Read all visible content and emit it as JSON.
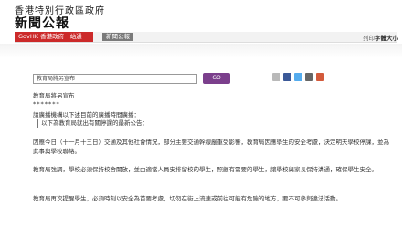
{
  "header": {
    "gov_name": "香港特別行政區政府",
    "title": "新聞公報"
  },
  "tabs": {
    "govhk": "GovHK 香港政府一站通",
    "archive": "新聞公報"
  },
  "tools": {
    "print": "列印",
    "font_size": "字體大小"
  },
  "search": {
    "value": "教育局將另宣布"
  },
  "go_button": "GO",
  "content": {
    "heading": "教育局將另宣布",
    "asterisks": "*******",
    "intro": "請廣播機構以下述目前的廣播時間廣播：",
    "quote": "以下為教育局就出有關停課的最新公告：",
    "para1": "因應今日（十一月十三日）交通及其他社會情況，部分主要交通幹線嚴重受影響，教育局因應學生的安全考慮，決定明天學校停課，並為此事與學校聯絡。",
    "para2": "教育局強調，學校必須保持校舍開放，並由適當人員安排留校的學生，照顧有需要的學生，讓學校與家長保持溝通，確保學生安全。",
    "para3": "教育局再次提醒學生，必須時刻以安全為首要考慮，切勿在街上流連或前往可能有危險的地方，要不可參與違法活動。"
  }
}
